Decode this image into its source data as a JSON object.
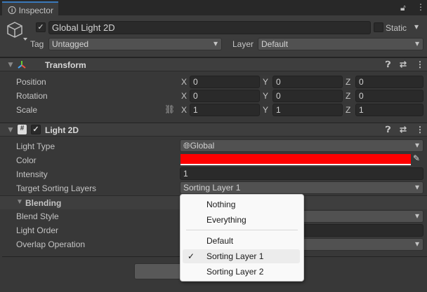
{
  "tab": {
    "title": "Inspector"
  },
  "object": {
    "active": true,
    "name": "Global Light 2D",
    "static_label": "Static",
    "tag_label": "Tag",
    "tag": "Untagged",
    "layer_label": "Layer",
    "layer": "Default"
  },
  "transform": {
    "title": "Transform",
    "rows": [
      {
        "label": "Position",
        "x": "0",
        "y": "0",
        "z": "0"
      },
      {
        "label": "Rotation",
        "x": "0",
        "y": "0",
        "z": "0"
      },
      {
        "label": "Scale",
        "x": "1",
        "y": "1",
        "z": "1"
      }
    ]
  },
  "axes": {
    "x": "X",
    "y": "Y",
    "z": "Z"
  },
  "light2d": {
    "title": "Light 2D",
    "enabled": true,
    "light_type_label": "Light Type",
    "light_type": "Global",
    "color_label": "Color",
    "color": "#ff0000",
    "intensity_label": "Intensity",
    "intensity": "1",
    "sorting_label": "Target Sorting Layers",
    "sorting": "Sorting Layer 1",
    "blending_title": "Blending",
    "blend_style_label": "Blend Style",
    "light_order_label": "Light Order",
    "overlap_label": "Overlap Operation"
  },
  "menu": {
    "items": [
      "Nothing",
      "Everything",
      "Default",
      "Sorting Layer 1",
      "Sorting Layer 2"
    ],
    "selected": "Sorting Layer 1"
  }
}
